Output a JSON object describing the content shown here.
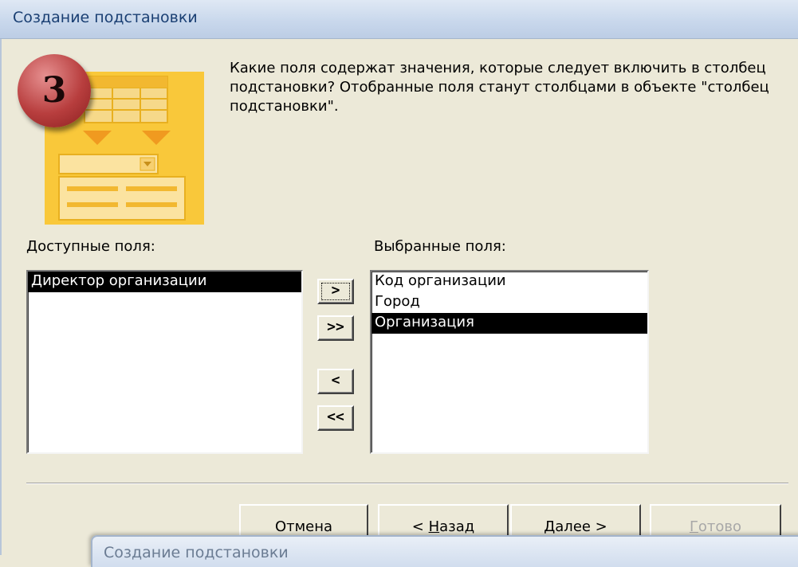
{
  "window": {
    "title": "Создание подстановки"
  },
  "step_badge": {
    "number": "3"
  },
  "question": "Какие поля содержат значения, которые следует включить в столбец подстановки? Отобранные поля станут столбцами в объекте \"столбец подстановки\".",
  "available": {
    "label": "Доступные поля:",
    "items": [
      {
        "label": "Директор организации",
        "selected": true
      }
    ]
  },
  "selected_fields": {
    "label": "Выбранные поля:",
    "items": [
      {
        "label": "Код организации",
        "selected": false
      },
      {
        "label": "Город",
        "selected": false
      },
      {
        "label": "Организация",
        "selected": true
      }
    ]
  },
  "move_buttons": {
    "add_one": ">",
    "add_all": ">>",
    "remove_one": "<",
    "remove_all": "<<"
  },
  "buttons": {
    "cancel": "Отмена",
    "back_prefix": "< ",
    "back_accel": "Н",
    "back_rest": "азад",
    "next_accel": "Д",
    "next_rest": "алее >",
    "finish_accel": "Г",
    "finish_rest": "отово"
  },
  "overlay_window": {
    "title": "Создание подстановки"
  },
  "icons": [
    "table-arrows-combobox-icon"
  ],
  "colors": {
    "titlebar": "#c9d8ec",
    "dialog": "#ece9d8",
    "selection": "#000000",
    "badge": "#b83e3e",
    "illustration": "#f9c83a"
  }
}
